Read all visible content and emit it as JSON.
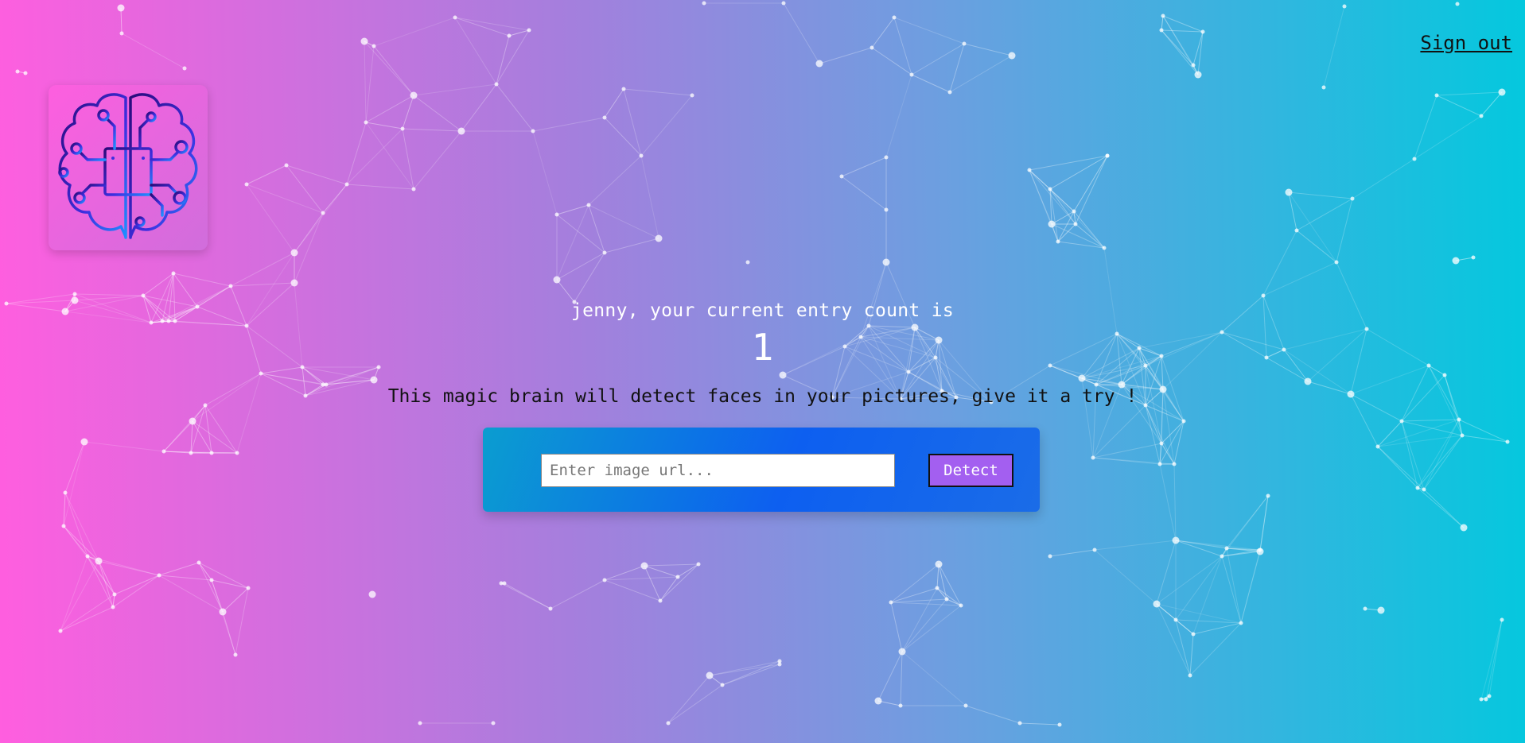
{
  "nav": {
    "signout_label": "Sign out"
  },
  "logo": {
    "icon": "brain-circuit-icon",
    "colors": [
      "#2a0a7a",
      "#3d2fe0",
      "#1e90ff"
    ]
  },
  "rank": {
    "line": "jenny, your current entry count is",
    "count": "1"
  },
  "intro": {
    "text": "This magic brain will detect faces in your pictures, give it a try !"
  },
  "form": {
    "input_placeholder": "Enter image url...",
    "input_value": "",
    "button_label": "Detect"
  },
  "theme": {
    "gradient_start": "#ff5edf",
    "gradient_end": "#04c8de",
    "button_color": "#a35ff0"
  }
}
